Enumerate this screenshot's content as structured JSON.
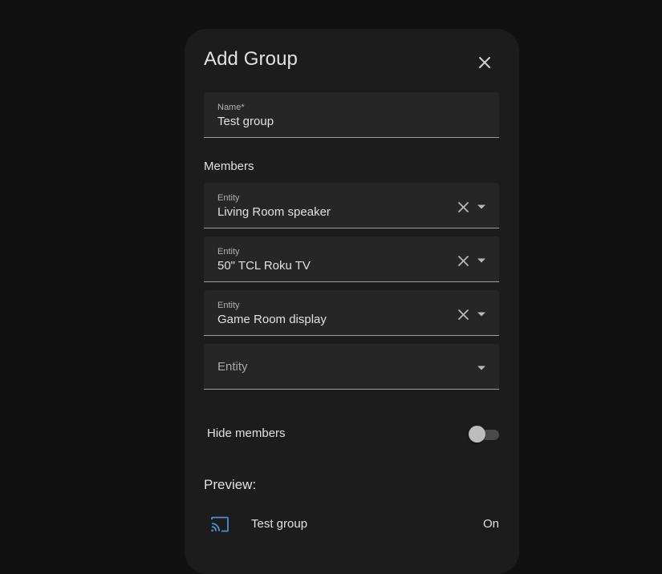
{
  "dialog": {
    "title": "Add Group",
    "close_icon": "close-icon"
  },
  "name_field": {
    "label": "Name*",
    "value": "Test group"
  },
  "members": {
    "label": "Members",
    "entities": [
      {
        "label": "Entity",
        "value": "Living Room speaker"
      },
      {
        "label": "Entity",
        "value": "50\" TCL Roku TV"
      },
      {
        "label": "Entity",
        "value": "Game Room display"
      }
    ],
    "empty_entity": {
      "placeholder": "Entity"
    }
  },
  "hide_members": {
    "label": "Hide members",
    "checked": false
  },
  "preview": {
    "label": "Preview:",
    "icon": "cast-icon",
    "name": "Test group",
    "state": "On"
  },
  "colors": {
    "background": "#111111",
    "dialog": "#1c1c1c",
    "field": "#262626",
    "text": "#e1e1e1",
    "cast_icon": "#4a90d9"
  }
}
